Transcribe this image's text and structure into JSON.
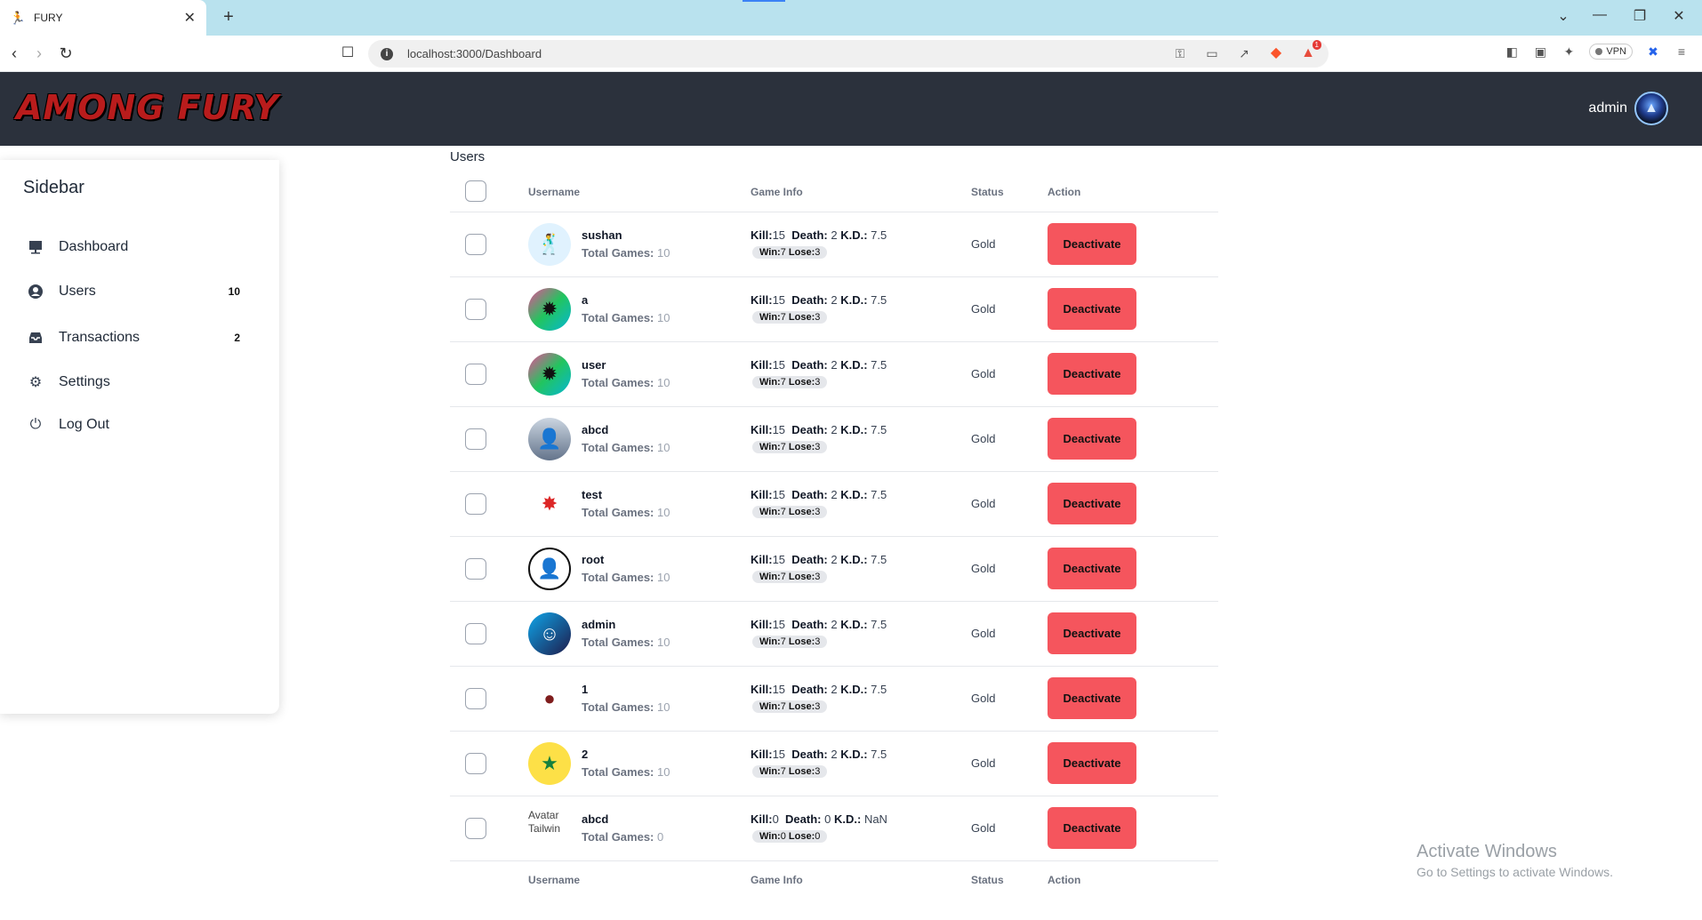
{
  "browser": {
    "tab_title": "FURY",
    "tab_close": "✕",
    "new_tab": "+",
    "url": "localhost:3000/Dashboard",
    "vpn_label": "VPN",
    "bat_badge": "1"
  },
  "app": {
    "logo_text": "AMONG FURY",
    "user_name": "admin"
  },
  "sidebar": {
    "title": "Sidebar",
    "items": [
      {
        "label": "Dashboard",
        "count": "",
        "icon": "presentation-icon"
      },
      {
        "label": "Users",
        "count": "10",
        "icon": "user-circle-icon"
      },
      {
        "label": "Transactions",
        "count": "2",
        "icon": "inbox-icon"
      },
      {
        "label": "Settings",
        "count": "",
        "icon": "gear-icon"
      },
      {
        "label": "Log Out",
        "count": "",
        "icon": "power-icon"
      }
    ]
  },
  "main": {
    "section_title": "Users",
    "columns": [
      "Username",
      "Game Info",
      "Status",
      "Action"
    ],
    "labels": {
      "total_games": "Total Games:",
      "kill": "Kill:",
      "death": "Death:",
      "kd": "K.D.:",
      "win": "Win:",
      "lose": "Lose:"
    },
    "rows": [
      {
        "username": "sushan",
        "total_games": "10",
        "kill": "15",
        "death": "2",
        "kd": "7.5",
        "win": "7",
        "lose": "3",
        "status": "Gold",
        "action": "Deactivate",
        "avatar": "stick-figure-avatar"
      },
      {
        "username": "a",
        "total_games": "10",
        "kill": "15",
        "death": "2",
        "kd": "7.5",
        "win": "7",
        "lose": "3",
        "status": "Gold",
        "action": "Deactivate",
        "avatar": "graffiti-avatar"
      },
      {
        "username": "user",
        "total_games": "10",
        "kill": "15",
        "death": "2",
        "kd": "7.5",
        "win": "7",
        "lose": "3",
        "status": "Gold",
        "action": "Deactivate",
        "avatar": "graffiti-avatar"
      },
      {
        "username": "abcd",
        "total_games": "10",
        "kill": "15",
        "death": "2",
        "kd": "7.5",
        "win": "7",
        "lose": "3",
        "status": "Gold",
        "action": "Deactivate",
        "avatar": "silhouette-avatar"
      },
      {
        "username": "test",
        "total_games": "10",
        "kill": "15",
        "death": "2",
        "kd": "7.5",
        "win": "7",
        "lose": "3",
        "status": "Gold",
        "action": "Deactivate",
        "avatar": "comic-burst-avatar"
      },
      {
        "username": "root",
        "total_games": "10",
        "kill": "15",
        "death": "2",
        "kd": "7.5",
        "win": "7",
        "lose": "3",
        "status": "Gold",
        "action": "Deactivate",
        "avatar": "anonymous-emblem-avatar"
      },
      {
        "username": "admin",
        "total_games": "10",
        "kill": "15",
        "death": "2",
        "kd": "7.5",
        "win": "7",
        "lose": "3",
        "status": "Gold",
        "action": "Deactivate",
        "avatar": "mask-avatar"
      },
      {
        "username": "1",
        "total_games": "10",
        "kill": "15",
        "death": "2",
        "kd": "7.5",
        "win": "7",
        "lose": "3",
        "status": "Gold",
        "action": "Deactivate",
        "avatar": "kidney-avatar"
      },
      {
        "username": "2",
        "total_games": "10",
        "kill": "15",
        "death": "2",
        "kd": "7.5",
        "win": "7",
        "lose": "3",
        "status": "Gold",
        "action": "Deactivate",
        "avatar": "family-guy-avatar"
      },
      {
        "username": "abcd",
        "total_games": "0",
        "kill": "0",
        "death": "0",
        "kd": "NaN",
        "win": "0",
        "lose": "0",
        "status": "Gold",
        "action": "Deactivate",
        "avatar": "broken-image-avatar",
        "avatar_alt": "Avatar Tailwin"
      }
    ]
  },
  "watermark": {
    "line1": "Activate Windows",
    "line2": "Go to Settings to activate Windows."
  },
  "colors": {
    "header_bg": "#2b313c",
    "deactivate_bg": "#f5555d",
    "tabbar_bg": "#b9e2ee"
  }
}
